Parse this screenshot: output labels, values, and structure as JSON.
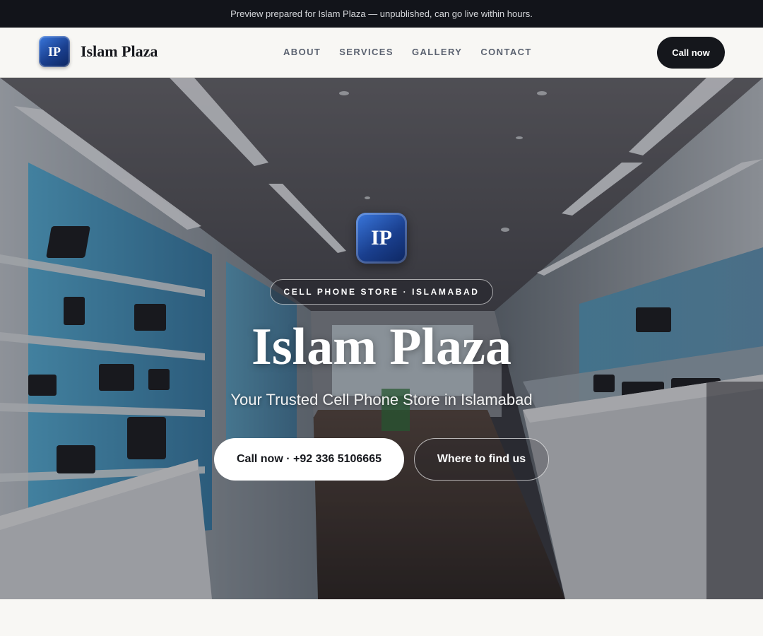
{
  "preview_banner": {
    "text": "Preview prepared for Islam Plaza — unpublished, can go live within hours."
  },
  "navbar": {
    "logo_initials": "IP",
    "brand_name": "Islam Plaza",
    "links": [
      "ABOUT",
      "SERVICES",
      "GALLERY",
      "CONTACT"
    ],
    "cta_label": "Call now"
  },
  "hero": {
    "logo_initials": "IP",
    "eyebrow": "CELL PHONE STORE · ISLAMABAD",
    "title": "Islam Plaza",
    "subtitle": "Your Trusted Cell Phone Store in Islamabad",
    "primary_button": "Call now · +92 336 5106665",
    "secondary_button": "Where to find us",
    "background_image": "phone store interior with glass display shelves"
  },
  "colors": {
    "dark": "#15171c",
    "page_bg": "#f8f7f4",
    "logo_blue": "#1a3f8e",
    "shelf_accent": "#29a6e0"
  }
}
